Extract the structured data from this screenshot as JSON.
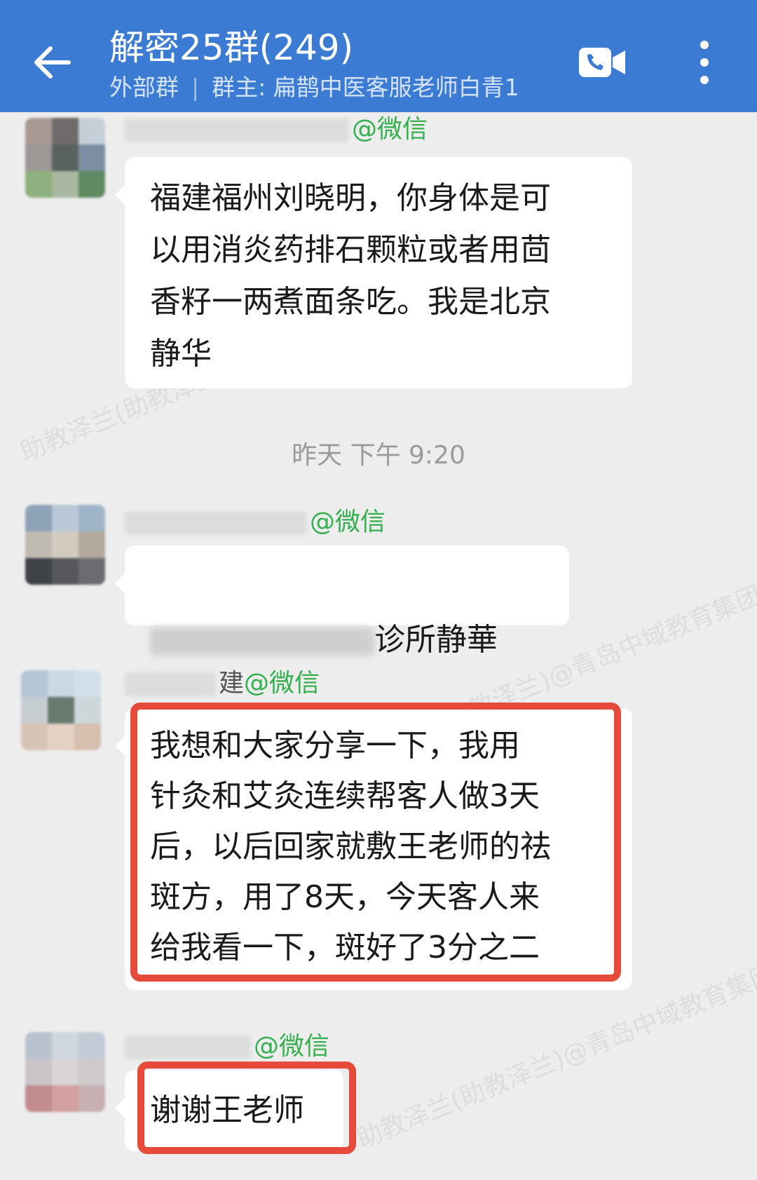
{
  "header": {
    "title": "解密25群(249)",
    "group_type": "外部群",
    "owner_label": "群主: 扁鹊中医客服老师白青1"
  },
  "icons": {
    "back": "arrow-left-icon",
    "video_call": "video-call-icon",
    "more": "more-vertical-icon"
  },
  "messages": [
    {
      "sender_suffix": "@微信",
      "text": "福建福州刘晓明，你身体是可\n以用消炎药排石颗粒或者用茴\n香籽一两煮面条吃。我是北京\n静华"
    },
    {
      "sender_suffix": "@微信",
      "text_visible": "诊所静華",
      "emoji": "confused-face-emoji"
    },
    {
      "sender_partial": "建",
      "sender_suffix": "@微信",
      "text": "我想和大家分享一下，我用\n针灸和艾灸连续帮客人做3天\n后，以后回家就敷王老师的祛\n斑方，用了8天，今天客人来\n给我看一下，斑好了3分之二"
    },
    {
      "sender_suffix": "@微信",
      "text": "谢谢王老师"
    }
  ],
  "timestamp": "昨天 下午 9:20",
  "watermark": "助教泽兰(助教泽兰)@青岛中域教育集团",
  "colors": {
    "header_bg": "#3c7bd3",
    "sender_green": "#34b04e",
    "highlight_red": "#e64a3b",
    "chat_bg": "#ededed"
  }
}
